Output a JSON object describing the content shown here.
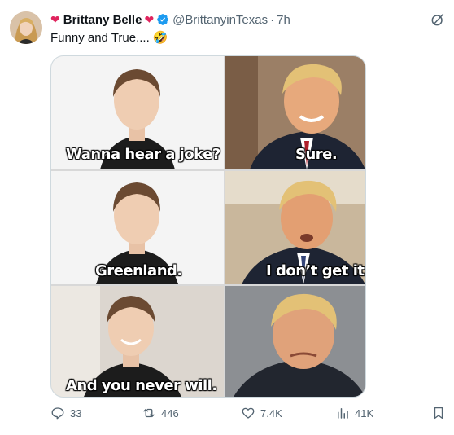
{
  "tweet": {
    "display_name": "Brittany Belle",
    "handle": "@BrittanyinTexas",
    "separator": "·",
    "time": "7h",
    "text": "Funny and True....",
    "text_emoji": "🤣"
  },
  "meme": {
    "captions": [
      "Wanna hear a joke?",
      "Sure.",
      "Greenland.",
      "I don’t get it.",
      "And you never will."
    ]
  },
  "actions": {
    "replies": "33",
    "reposts": "446",
    "likes": "7.4K",
    "views": "41K"
  },
  "colors": {
    "verified": "#1d9bf0",
    "heart": "#e0245e",
    "muted": "#536471"
  }
}
